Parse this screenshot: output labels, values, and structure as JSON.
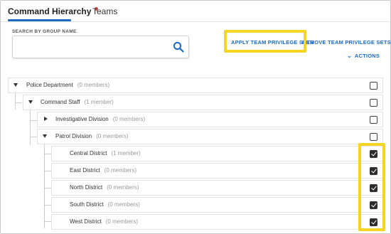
{
  "tabs": [
    {
      "label": "Command Hierarchy",
      "active": true,
      "has_alert_dot": true
    },
    {
      "label": "Teams",
      "active": false
    }
  ],
  "search": {
    "label": "SEARCH BY GROUP NAME",
    "value": "",
    "placeholder": ""
  },
  "actions": {
    "apply_label": "APPLY TEAM PRIVILEGE SETS",
    "remove_label": "REMOVE TEAM PRIVILEGE SETS",
    "menu_label": "ACTIONS"
  },
  "tree": [
    {
      "name": "Police Department",
      "count": "(0 members)",
      "level": 0,
      "expander": "expanded",
      "checked": false
    },
    {
      "name": "Command Staff",
      "count": "(1 member)",
      "level": 1,
      "expander": "expanded",
      "checked": false
    },
    {
      "name": "Investigative Division",
      "count": "(0 members)",
      "level": 2,
      "expander": "collapsed",
      "checked": false
    },
    {
      "name": "Patrol Division",
      "count": "(0 members)",
      "level": 2,
      "expander": "expanded",
      "checked": false
    },
    {
      "name": "Central District",
      "count": "(1 member)",
      "level": 3,
      "expander": "none",
      "checked": true
    },
    {
      "name": "East District",
      "count": "(0 members)",
      "level": 3,
      "expander": "none",
      "checked": true
    },
    {
      "name": "North District",
      "count": "(0 members)",
      "level": 3,
      "expander": "none",
      "checked": true
    },
    {
      "name": "South District",
      "count": "(0 members)",
      "level": 3,
      "expander": "none",
      "checked": true
    },
    {
      "name": "West District",
      "count": "(0 members)",
      "level": 3,
      "expander": "none",
      "checked": true
    }
  ],
  "colors": {
    "accent": "#1d6bc4",
    "highlight": "#f4d524",
    "alert_dot": "#e0474c"
  }
}
